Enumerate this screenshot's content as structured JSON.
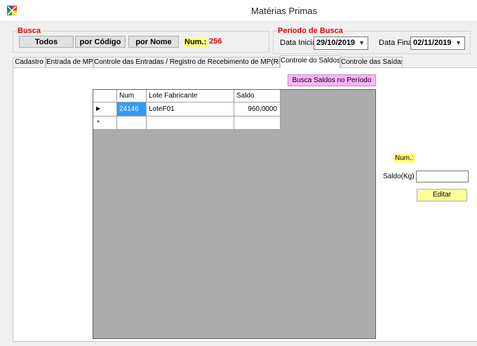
{
  "window": {
    "title": "Matérias Primas"
  },
  "busca": {
    "legend": "Busca",
    "todos_label": "Todos",
    "por_codigo_label": "por Código",
    "por_nome_label": "por Nome",
    "num_label": "Num.:",
    "num_value": "256"
  },
  "periodo": {
    "legend": "Período de Busca",
    "data_inicial_label": "Data Inicial",
    "data_inicial_value": "29/10/2019",
    "data_final_label": "Data Final",
    "data_final_value": "02/11/2019"
  },
  "tabs": [
    {
      "label": "Cadastro"
    },
    {
      "label": "Entrada de MP"
    },
    {
      "label": "Controle das Entradas / Registro de Recebimento de MP(RRMP)"
    },
    {
      "label": "Controle do Saldos",
      "active": true
    },
    {
      "label": "Controle das Saídas"
    }
  ],
  "saldos": {
    "busca_button_label": "Busca Saldos no Período",
    "columns": [
      "Num",
      "Lote Fabricante",
      "Saldo"
    ],
    "rows": [
      {
        "num": "24146",
        "lote": "LoteF01",
        "saldo": "960,0000"
      }
    ],
    "current_row_marker": "▶",
    "new_row_marker": "*",
    "num_label": "Num.:",
    "saldo_label": "Saldo(Kg)",
    "saldo_value": "",
    "editar_label": "Editar"
  },
  "colors": {
    "legend_red": "#e00000",
    "highlight_yellow": "#ffff80",
    "pink_button": "#ffb3ff",
    "selection_blue": "#3399ff",
    "grid_background": "#acacac"
  }
}
